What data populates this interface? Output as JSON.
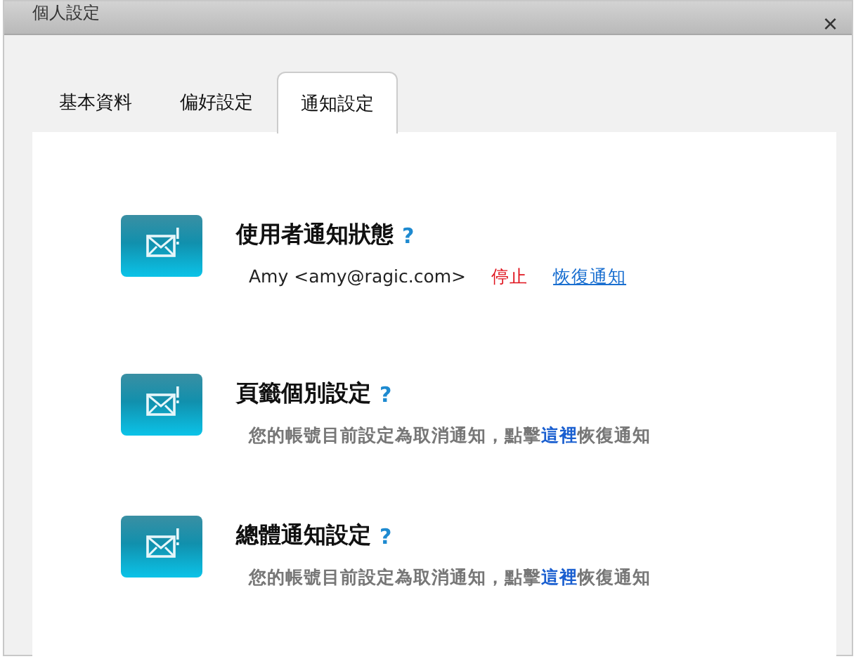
{
  "window": {
    "title": "個人設定",
    "close": "×"
  },
  "tabs": [
    {
      "label": "基本資料",
      "selected": false
    },
    {
      "label": "偏好設定",
      "selected": false
    },
    {
      "label": "通知設定",
      "selected": true
    }
  ],
  "sections": [
    {
      "kind": "user",
      "title": "使用者通知狀態",
      "help": "?",
      "user": "Amy <amy@ragic.com>",
      "stop": "停止",
      "restore": "恢復通知"
    },
    {
      "kind": "message",
      "title": "頁籤個別設定",
      "help": "?",
      "before": "您的帳號目前設定為取消通知，點擊",
      "link": "這裡",
      "after": "恢復通知"
    },
    {
      "kind": "message",
      "title": "總體通知設定",
      "help": "?",
      "before": "您的帳號目前設定為取消通知，點擊",
      "link": "這裡",
      "after": "恢復通知"
    }
  ]
}
